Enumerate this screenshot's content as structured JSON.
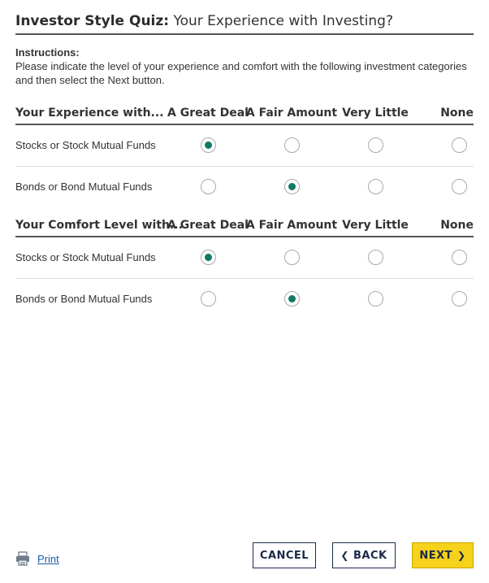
{
  "header": {
    "title_bold": "Investor Style Quiz:",
    "title_rest": " Your Experience with Investing?"
  },
  "instructions": {
    "heading": "Instructions:",
    "body": "Please indicate the level of your experience and comfort with the following investment categories and then select the Next button."
  },
  "columns": [
    "A Great Deal",
    "A Fair Amount",
    "Very Little",
    "None"
  ],
  "sections": [
    {
      "heading": "Your Experience with...",
      "rows": [
        {
          "label": "Stocks or Stock Mutual Funds",
          "selected": "A Great Deal"
        },
        {
          "label": "Bonds or Bond Mutual Funds",
          "selected": "A Fair Amount"
        }
      ]
    },
    {
      "heading": "Your Comfort Level with...",
      "rows": [
        {
          "label": "Stocks or Stock Mutual Funds",
          "selected": "A Great Deal"
        },
        {
          "label": "Bonds or Bond Mutual Funds",
          "selected": "A Fair Amount"
        }
      ]
    }
  ],
  "footer": {
    "print_label": "Print",
    "print_icon": "printer-icon",
    "cancel_label": "CANCEL",
    "back_label": "BACK",
    "back_icon": "chevron-left-icon",
    "next_label": "NEXT",
    "next_icon": "chevron-right-icon"
  },
  "colors": {
    "selected_radio": "#0f7a67",
    "next_button": "#f6d21a",
    "link": "#1a5ca8",
    "button_text": "#1b2a4a"
  }
}
